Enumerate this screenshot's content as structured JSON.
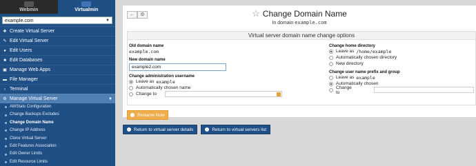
{
  "sidebar": {
    "tabs": [
      {
        "label": "Webmin",
        "active": false
      },
      {
        "label": "Virtualmin",
        "active": true
      }
    ],
    "domain_select": {
      "value": "example.com"
    },
    "menu": [
      {
        "label": "Create Virtual Server",
        "icon": "plus-icon"
      },
      {
        "label": "Edit Virtual Server",
        "icon": "edit-icon"
      },
      {
        "label": "Edit Users",
        "icon": "users-icon"
      },
      {
        "label": "Edit Databases",
        "icon": "database-icon"
      },
      {
        "label": "Manage Web Apps",
        "icon": "apps-icon"
      },
      {
        "label": "File Manager",
        "icon": "folder-icon"
      },
      {
        "label": "Terminal",
        "icon": "terminal-icon"
      },
      {
        "label": "Manage Virtual Server",
        "icon": "gears-icon",
        "open": true
      }
    ],
    "submenu": [
      {
        "label": "AWStats Configuration"
      },
      {
        "label": "Change Backups Excludes"
      },
      {
        "label": "Change Domain Name",
        "active": true
      },
      {
        "label": "Change IP Address"
      },
      {
        "label": "Clone Virtual Server"
      },
      {
        "label": "Edit Features Association"
      },
      {
        "label": "Edit Owner Limits"
      },
      {
        "label": "Edit Resource Limits"
      }
    ]
  },
  "header": {
    "title": "Change Domain Name",
    "subtitle_prefix": "In domain",
    "subtitle_domain": "example.com"
  },
  "form": {
    "heading": "Virtual server domain name change options",
    "old_domain_label": "Old domain name",
    "old_domain_value": "example.com",
    "new_domain_label": "New domain name",
    "new_domain_value": "example2.com",
    "admin_user_label": "Change administration username",
    "admin_user_options": [
      {
        "label": "Leave as",
        "mono": "example",
        "selected": true
      },
      {
        "label": "Automatically chosen name",
        "mono": "",
        "selected": false
      },
      {
        "label": "Change to",
        "mono": "",
        "selected": false
      }
    ],
    "home_dir_label": "Change home directory",
    "home_dir_options": [
      {
        "label": "Leave as",
        "mono": "/home/example",
        "selected": true
      },
      {
        "label": "Automatically chosen directory",
        "mono": "",
        "selected": false
      },
      {
        "label": "New directory",
        "mono": "",
        "selected": false
      }
    ],
    "prefix_label": "Change user name prefix and group",
    "prefix_options": [
      {
        "label": "Leave as",
        "mono": "example",
        "selected": false
      },
      {
        "label": "Automatically chosen",
        "mono": "",
        "selected": true
      },
      {
        "label": "Change to",
        "mono": "",
        "selected": false
      }
    ],
    "rename_button": "Rename Now"
  },
  "footer": {
    "return_details": "Return to virtual server details",
    "return_list": "Return to virtual servers list"
  },
  "colors": {
    "sidebar_bg": "#1f4f85",
    "rename_btn": "#f0ad4e",
    "footer_btn": "#1f4f85"
  }
}
